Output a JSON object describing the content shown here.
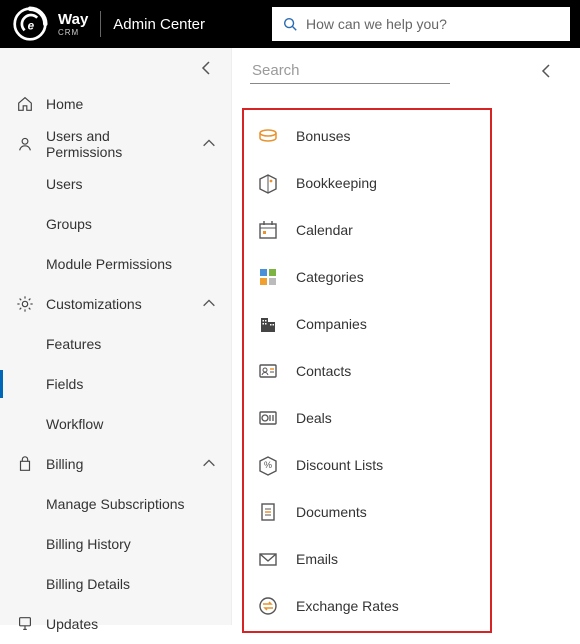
{
  "top": {
    "brand_crm": "CRM",
    "title": "Admin Center",
    "search_placeholder": "How can we help you?"
  },
  "sidebar": {
    "items": [
      {
        "label": "Home",
        "icon": "home-icon",
        "interact": true
      },
      {
        "label": "Users and Permissions",
        "icon": "user-icon",
        "expandable": true,
        "expanded": true
      },
      {
        "label": "Users",
        "child": true
      },
      {
        "label": "Groups",
        "child": true
      },
      {
        "label": "Module Permissions",
        "child": true
      },
      {
        "label": "Customizations",
        "icon": "gear-icon",
        "expandable": true,
        "expanded": true
      },
      {
        "label": "Features",
        "child": true
      },
      {
        "label": "Fields",
        "child": true,
        "active": true
      },
      {
        "label": "Workflow",
        "child": true
      },
      {
        "label": "Billing",
        "icon": "bag-icon",
        "expandable": true,
        "expanded": true
      },
      {
        "label": "Manage Subscriptions",
        "child": true
      },
      {
        "label": "Billing History",
        "child": true
      },
      {
        "label": "Billing Details",
        "child": true
      },
      {
        "label": "Updates",
        "icon": "updates-icon"
      }
    ]
  },
  "panel": {
    "search_placeholder": "Search",
    "items": [
      {
        "label": "Bonuses",
        "icon": "bonuses-icon"
      },
      {
        "label": "Bookkeeping",
        "icon": "bookkeeping-icon"
      },
      {
        "label": "Calendar",
        "icon": "calendar-icon"
      },
      {
        "label": "Categories",
        "icon": "categories-icon"
      },
      {
        "label": "Companies",
        "icon": "companies-icon"
      },
      {
        "label": "Contacts",
        "icon": "contacts-icon"
      },
      {
        "label": "Deals",
        "icon": "deals-icon"
      },
      {
        "label": "Discount Lists",
        "icon": "discount-icon"
      },
      {
        "label": "Documents",
        "icon": "documents-icon"
      },
      {
        "label": "Emails",
        "icon": "emails-icon"
      },
      {
        "label": "Exchange Rates",
        "icon": "exchange-icon"
      }
    ]
  },
  "colors": {
    "accent": "#0067b8",
    "highlight_border": "#d62424",
    "orange": "#e8932f"
  }
}
